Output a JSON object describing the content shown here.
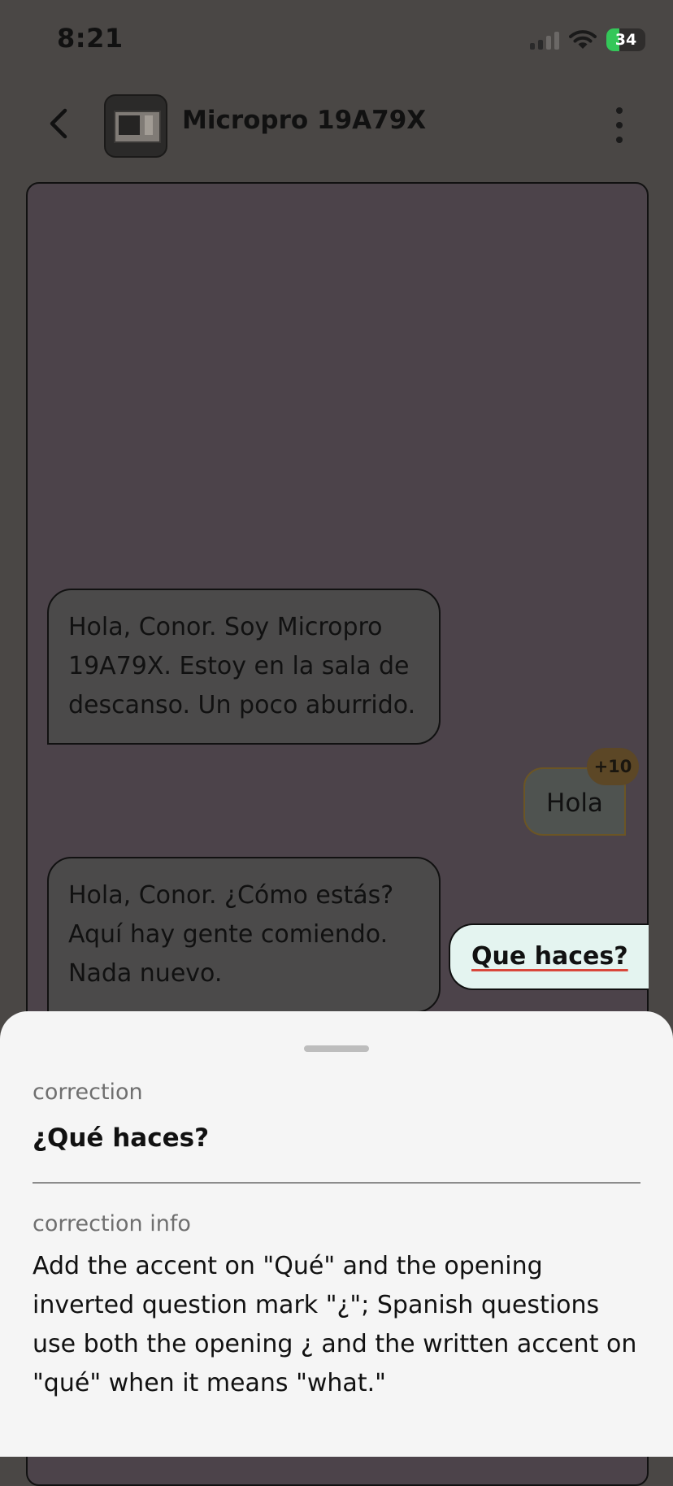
{
  "status_bar": {
    "time": "8:21",
    "battery_level": "34",
    "icons": [
      "cellular-signal-icon",
      "wifi-icon",
      "battery-charging-icon"
    ]
  },
  "header": {
    "title": "Micropro 19A79X",
    "back_icon": "chevron-left-icon",
    "menu_icon": "more-vertical-icon"
  },
  "messages": [
    {
      "sender": "bot",
      "text": "Hola, Conor. Soy Micropro 19A79X. Estoy en la sala de descanso. Un poco aburrido."
    },
    {
      "sender": "user",
      "text": "Hola",
      "badge": "+10"
    },
    {
      "sender": "bot",
      "text": "Hola, Conor. ¿Cómo estás? Aquí hay gente comiendo. Nada nuevo."
    }
  ],
  "draft": {
    "text": "Que haces?"
  },
  "sheet": {
    "correction_label": "correction",
    "correction": "¿Qué haces?",
    "info_label": "correction info",
    "info": "Add the accent on \"Qué\" and the opening inverted question mark \"¿\"; Spanish questions use both the opening ¿ and the written accent on \"qué\" when it means \"what.\""
  },
  "colors": {
    "backdrop": "#4a4745",
    "chat_panel": "#4c434a",
    "bot_bubble": "#4b4a4a",
    "user_bubble_border": "#6b5525",
    "draft_bubble": "#e4f4f0",
    "sheet": "#f5f5f5",
    "battery_green": "#34c759",
    "error_underline": "#d9473b"
  }
}
